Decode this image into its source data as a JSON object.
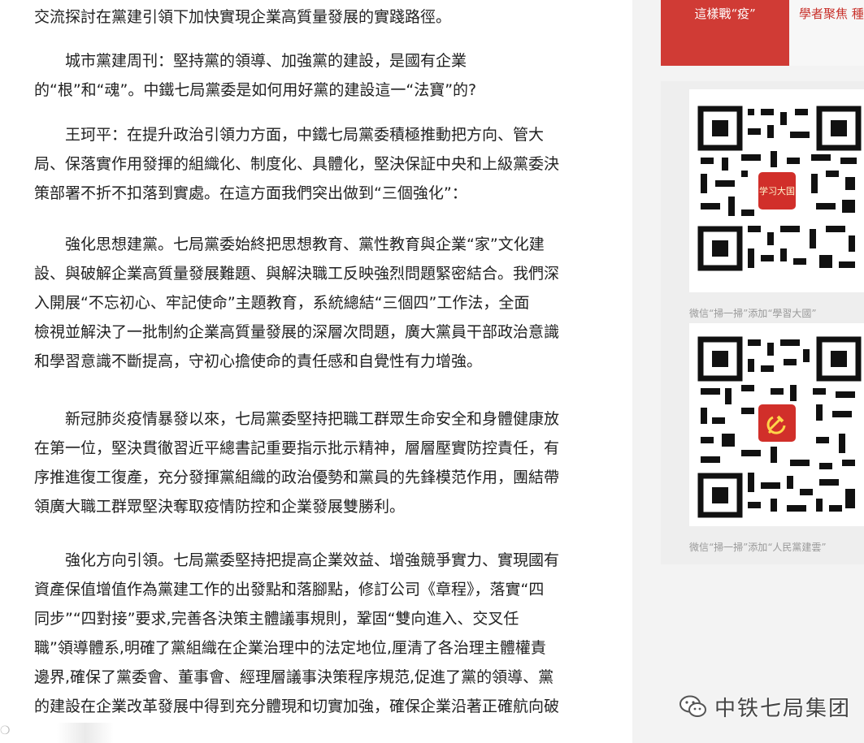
{
  "article": {
    "paragraphs": [
      "交流探討在黨建引領下加快實現企業高質量發展的實踐路徑。",
      "　　城市黨建周刊：堅持黨的領導、加強黨的建設，是國有企業\n的“根”和“魂”。中鐵七局黨委是如何用好黨的建設這一“法寶”的?",
      "　　王珂平：在提升政治引領力方面，中鐵七局黨委積極推動把方向、管大\n局、保落實作用發揮的組織化、制度化、具體化，堅決保証中央和上級黨委決\n策部署不折不扣落到實處。在這方面我們突出做到“三個強化”：",
      "　　強化思想建黨。七局黨委始終把思想教育、黨性教育與企業“家”文化建\n設、與破解企業高質量發展難題、與解決職工反映強烈問題緊密結合。我們深\n入開展“不忘初心、牢記使命”主題教育，系統總結“三個四”工作法，全面\n檢視並解決了一批制約企業高質量發展的深層次問題，廣大黨員干部政治意識\n和學習意識不斷提高，守初心擔使命的責任感和自覺性有力增強。",
      "　　新冠肺炎疫情暴發以來，七局黨委堅持把職工群眾生命安全和身體健康放\n在第一位，堅決貫徹習近平總書記重要指示批示精神，層層壓實防控責任，有\n序推進復工復產，充分發揮黨組織的政治優勢和黨員的先鋒模范作用，團結帶\n領廣大職工群眾堅決奪取疫情防控和企業發展雙勝利。",
      "　　強化方向引領。七局黨委堅持把提高企業效益、增強競爭實力、實現國有\n資產保值增值作為黨建工作的出發點和落腳點，修訂公司《章程》，落實“四\n同步”“四對接”要求,完善各決策主體議事規則，鞏固“雙向進入、交叉任\n職”領導體系,明確了黨組織在企業治理中的法定地位,厘清了各治理主體權責\n邊界,確保了黨委會、董事會、經理層議事決策程序規范,促進了黨的領導、黨\n的建設在企業改革發展中得到充分體現和切實加強，確保企業沿著正確航向破"
    ]
  },
  "sidebar": {
    "tabs": [
      {
        "label": "這樣戰“疫”"
      },
      {
        "label": "學者聚焦 種"
      }
    ],
    "qr_codes": [
      {
        "logo_text": "学习大国",
        "caption": "微信“掃一掃”添加“學習大國”"
      },
      {
        "logo_text": "",
        "caption": "微信“掃一掃”添加“人民黨建雲”"
      }
    ]
  },
  "watermark": {
    "text": "中铁七局集团"
  }
}
